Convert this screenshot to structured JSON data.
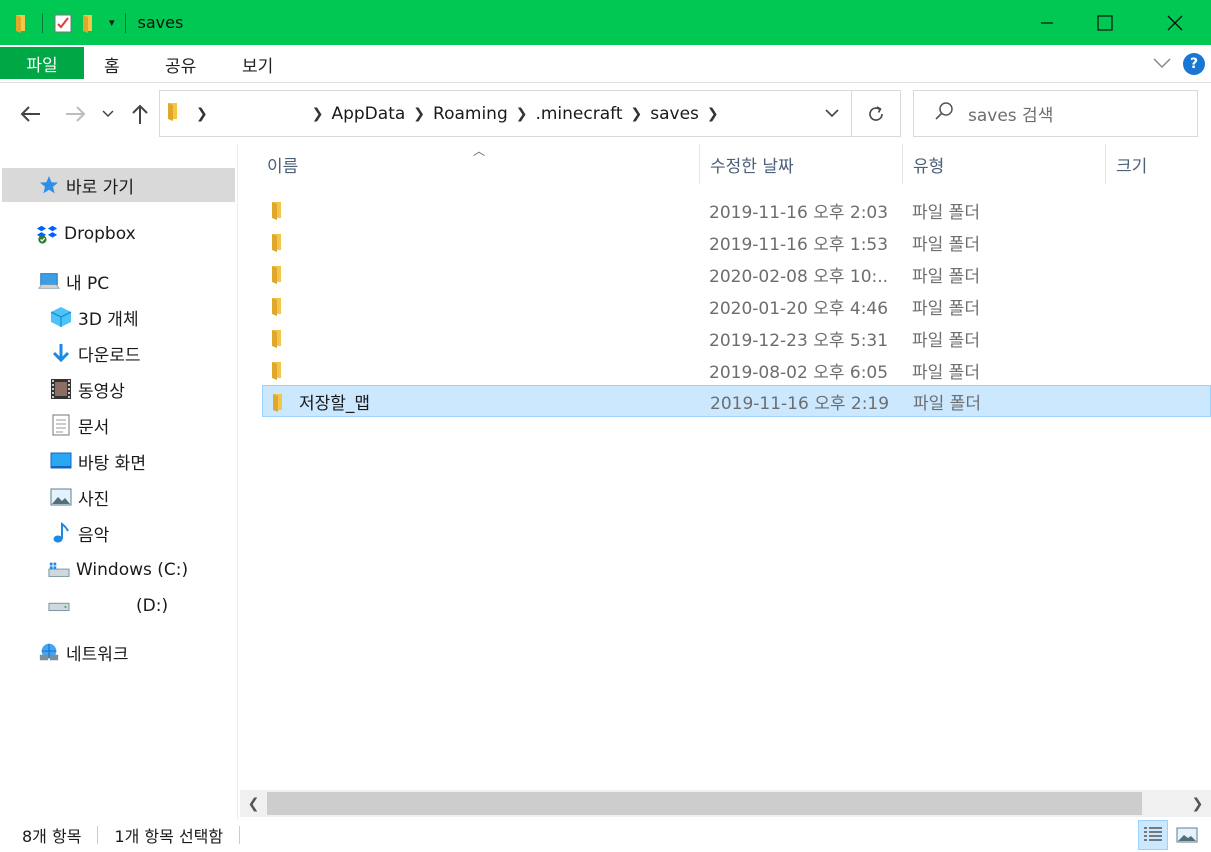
{
  "window": {
    "title": "saves",
    "accent": "#00c853"
  },
  "ribbon": {
    "tabs": [
      "파일",
      "홈",
      "공유",
      "보기"
    ],
    "help_label": "?"
  },
  "address": {
    "crumbs": [
      "AppData",
      "Roaming",
      ".minecraft",
      "saves"
    ],
    "search_placeholder": "saves 검색"
  },
  "sidebar": {
    "quick_access": "바로 가기",
    "dropbox": "Dropbox",
    "this_pc": "내 PC",
    "items": [
      {
        "label": "3D 개체",
        "icon": "3d-objects-icon"
      },
      {
        "label": "다운로드",
        "icon": "download-icon"
      },
      {
        "label": "동영상",
        "icon": "video-icon"
      },
      {
        "label": "문서",
        "icon": "document-icon"
      },
      {
        "label": "바탕 화면",
        "icon": "desktop-icon"
      },
      {
        "label": "사진",
        "icon": "picture-icon"
      },
      {
        "label": "음악",
        "icon": "music-icon"
      },
      {
        "label": "Windows (C:)",
        "icon": "drive-c-icon"
      },
      {
        "label": "(D:)",
        "icon": "drive-d-icon"
      }
    ],
    "network": "네트워크"
  },
  "columns": {
    "name": "이름",
    "modified": "수정한 날짜",
    "type": "유형",
    "size": "크기"
  },
  "files": [
    {
      "name": "",
      "modified": "2019-11-16 오후 2:03",
      "type": "파일 폴더"
    },
    {
      "name": "",
      "modified": "2019-11-16 오후 1:53",
      "type": "파일 폴더"
    },
    {
      "name": "",
      "modified": "2020-02-08 오후 10:...",
      "type": "파일 폴더"
    },
    {
      "name": "",
      "modified": "2020-01-20 오후 4:46",
      "type": "파일 폴더"
    },
    {
      "name": "",
      "modified": "2019-12-23 오후 5:31",
      "type": "파일 폴더"
    },
    {
      "name": "",
      "modified": "2019-08-02 오후 6:05",
      "type": "파일 폴더"
    },
    {
      "name": "저장할_맵",
      "modified": "2019-11-16 오후 2:19",
      "type": "파일 폴더",
      "selected": true
    }
  ],
  "status": {
    "count": "8개 항목",
    "selected": "1개 항목 선택함"
  }
}
